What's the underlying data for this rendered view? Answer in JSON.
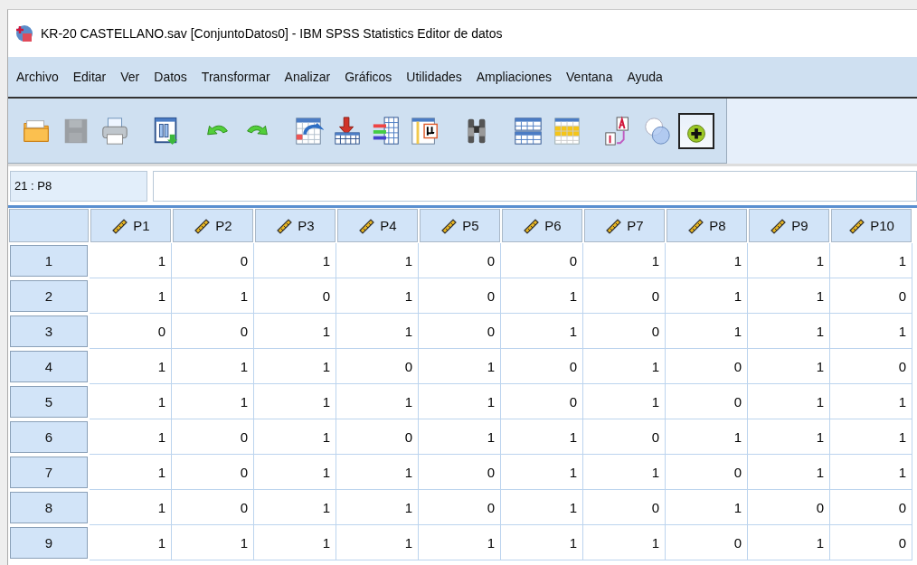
{
  "window": {
    "title": "KR-20 CASTELLANO.sav [ConjuntoDatos0] - IBM SPSS Statistics Editor de datos"
  },
  "menu": [
    "Archivo",
    "Editar",
    "Ver",
    "Datos",
    "Transformar",
    "Analizar",
    "Gráficos",
    "Utilidades",
    "Ampliaciones",
    "Ventana",
    "Ayuda"
  ],
  "toolbar": [
    {
      "kind": "folder",
      "disabled": false,
      "on": false
    },
    {
      "kind": "disk",
      "disabled": true,
      "on": false
    },
    {
      "kind": "printer",
      "disabled": false,
      "on": false
    },
    {
      "kind": "recall",
      "disabled": false,
      "on": false
    },
    {
      "kind": "undo",
      "disabled": false,
      "on": false
    },
    {
      "kind": "redo",
      "disabled": false,
      "on": false
    },
    {
      "kind": "gotocase",
      "disabled": false,
      "on": false
    },
    {
      "kind": "insert",
      "disabled": false,
      "on": false
    },
    {
      "kind": "variables",
      "disabled": false,
      "on": false
    },
    {
      "kind": "stats",
      "disabled": false,
      "on": false
    },
    {
      "kind": "find",
      "disabled": false,
      "on": false
    },
    {
      "kind": "split",
      "disabled": false,
      "on": false
    },
    {
      "kind": "select",
      "disabled": false,
      "on": false
    },
    {
      "kind": "labels",
      "disabled": false,
      "on": false
    },
    {
      "kind": "sets",
      "disabled": false,
      "on": false
    },
    {
      "kind": "addon",
      "disabled": false,
      "on": true
    }
  ],
  "cell_reference": "21 : P8",
  "table": {
    "columns": [
      "P1",
      "P2",
      "P3",
      "P4",
      "P5",
      "P6",
      "P7",
      "P8",
      "P9",
      "P10"
    ],
    "rows": [
      {
        "label": "1",
        "cells": [
          "1",
          "0",
          "1",
          "1",
          "0",
          "0",
          "1",
          "1",
          "1",
          "1"
        ]
      },
      {
        "label": "2",
        "cells": [
          "1",
          "1",
          "0",
          "1",
          "0",
          "1",
          "0",
          "1",
          "1",
          "0"
        ]
      },
      {
        "label": "3",
        "cells": [
          "0",
          "0",
          "1",
          "1",
          "0",
          "1",
          "0",
          "1",
          "1",
          "1"
        ]
      },
      {
        "label": "4",
        "cells": [
          "1",
          "1",
          "1",
          "0",
          "1",
          "0",
          "1",
          "0",
          "1",
          "0"
        ]
      },
      {
        "label": "5",
        "cells": [
          "1",
          "1",
          "1",
          "1",
          "1",
          "0",
          "1",
          "0",
          "1",
          "1"
        ]
      },
      {
        "label": "6",
        "cells": [
          "1",
          "0",
          "1",
          "0",
          "1",
          "1",
          "0",
          "1",
          "1",
          "1"
        ]
      },
      {
        "label": "7",
        "cells": [
          "1",
          "0",
          "1",
          "1",
          "0",
          "1",
          "1",
          "0",
          "1",
          "1"
        ]
      },
      {
        "label": "8",
        "cells": [
          "1",
          "0",
          "1",
          "1",
          "0",
          "1",
          "0",
          "1",
          "0",
          "0"
        ]
      },
      {
        "label": "9",
        "cells": [
          "1",
          "1",
          "1",
          "1",
          "1",
          "1",
          "1",
          "0",
          "1",
          "0"
        ]
      }
    ]
  }
}
